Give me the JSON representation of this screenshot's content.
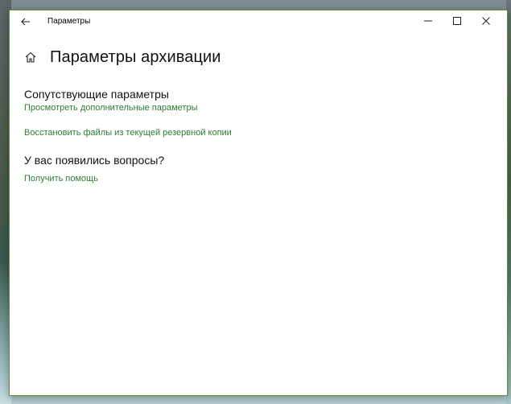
{
  "window": {
    "title": "Параметры"
  },
  "header": {
    "title": "Параметры архивации"
  },
  "related_settings": {
    "heading": "Сопутствующие параметры",
    "links": [
      "Просмотреть дополнительные параметры",
      "Восстановить файлы из текущей резервной копии"
    ]
  },
  "questions": {
    "heading": "У вас появились вопросы?",
    "link": "Получить помощь"
  },
  "icons": {
    "back": "back-arrow-icon",
    "home": "home-icon",
    "minimize": "minimize-icon",
    "maximize": "maximize-icon",
    "close": "close-icon"
  },
  "colors": {
    "accent_link": "#2f7d32",
    "window_border": "#5b8f3a"
  }
}
